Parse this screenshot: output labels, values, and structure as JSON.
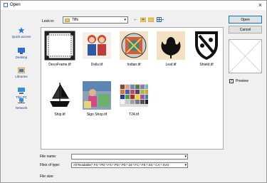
{
  "window": {
    "title": "Open"
  },
  "lookin": {
    "label": "Look in:",
    "value": "Tiffs"
  },
  "places": [
    {
      "label": "Quick access",
      "icon": "star-icon"
    },
    {
      "label": "Desktop",
      "icon": "desktop-icon"
    },
    {
      "label": "Libraries",
      "icon": "libraries-icon"
    },
    {
      "label": "This PC",
      "icon": "computer-icon"
    },
    {
      "label": "Network",
      "icon": "network-icon"
    }
  ],
  "files": [
    {
      "name": "DecoFrame.tif"
    },
    {
      "name": "Dolls.tif"
    },
    {
      "name": "Indian.tif"
    },
    {
      "name": "Leaf.tif"
    },
    {
      "name": "Shield.tif"
    },
    {
      "name": "Ship.tif"
    },
    {
      "name": "Sign Shop.tif"
    },
    {
      "name": "T24.tif"
    }
  ],
  "buttons": {
    "open": "Open",
    "cancel": "Cancel"
  },
  "preview": {
    "label": "Preview",
    "checked": true
  },
  "filename": {
    "label": "File name:",
    "value": ""
  },
  "filetype": {
    "label": "Files of type:",
    "value": "All Readable(*.FS;*.PD;*.FS;*.PD;*.PD;*.Dt;*.FC;*.FE;*.SS;*.CA;*.SVG"
  },
  "filesize": {
    "label": "File size:"
  },
  "colors": {
    "accent": "#0078d7",
    "folder": "#e8c46a",
    "link": "#1b3a8c"
  }
}
